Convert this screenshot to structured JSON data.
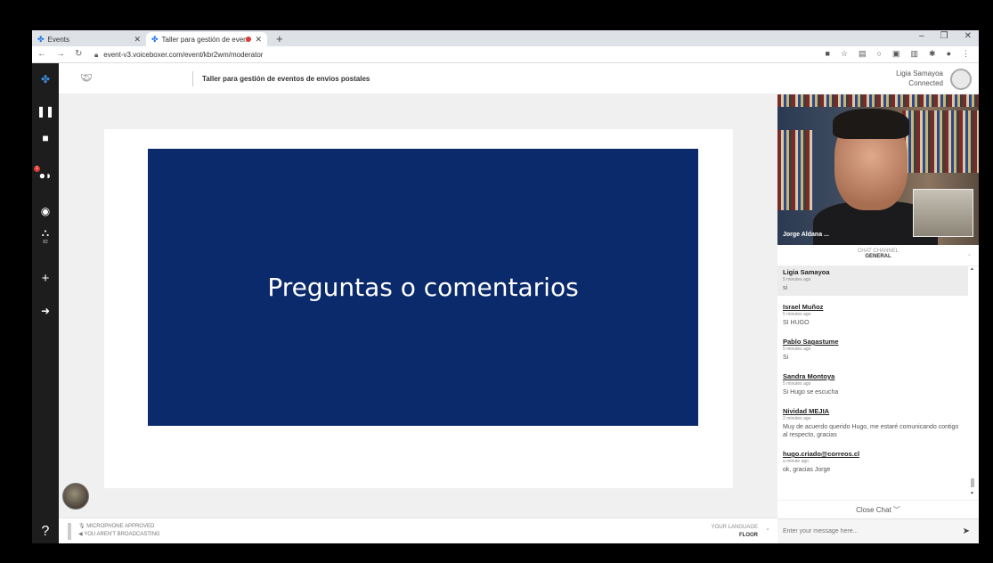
{
  "browser": {
    "tabs": [
      {
        "label": "Events"
      },
      {
        "label": "Taller para gestión de event"
      }
    ],
    "url": "event-v3.voiceboxer.com/event/kbr2wm/moderator"
  },
  "header": {
    "event_title": "Taller para gestión de eventos de envios postales",
    "user_name": "Ligia Samayoa",
    "user_status": "Connected"
  },
  "sidebar": {
    "badge": "1",
    "attendee_count": "82"
  },
  "slide": {
    "text": "Preguntas o comentarios"
  },
  "status": {
    "mic": "MICROPHONE APPROVED",
    "broadcast": "YOU AREN'T BROADCASTING",
    "language_label": "YOUR LANGUAGE",
    "language_value": "FLOOR"
  },
  "video": {
    "speaker_name": "Jorge Aldana ..."
  },
  "chat": {
    "channel_label": "CHAT CHANNEL",
    "channel_name": "GENERAL",
    "messages": [
      {
        "author": "Ligia Samayoa",
        "time": "5 minutes ago",
        "text": "si"
      },
      {
        "author": "Israel Muñoz",
        "time": "5 minutes ago",
        "text": "SI HUGO"
      },
      {
        "author": "Pablo Sagastume",
        "time": "5 minutes ago",
        "text": "Si"
      },
      {
        "author": "Sandra Montoya",
        "time": "5 minutes ago",
        "text": "Si Hugo se escucha"
      },
      {
        "author": "Nividad MEJIA",
        "time": "2 minutes ago",
        "text": "Muy de acuerdo querido Hugo, me estaré comunicando contigo al respecto, gracias"
      },
      {
        "author": "hugo.criado@correos.cl",
        "time": "a minute ago",
        "text": "ok, gracias Jorge"
      }
    ],
    "close_label": "Close Chat",
    "input_placeholder": "Enter your message here..."
  }
}
